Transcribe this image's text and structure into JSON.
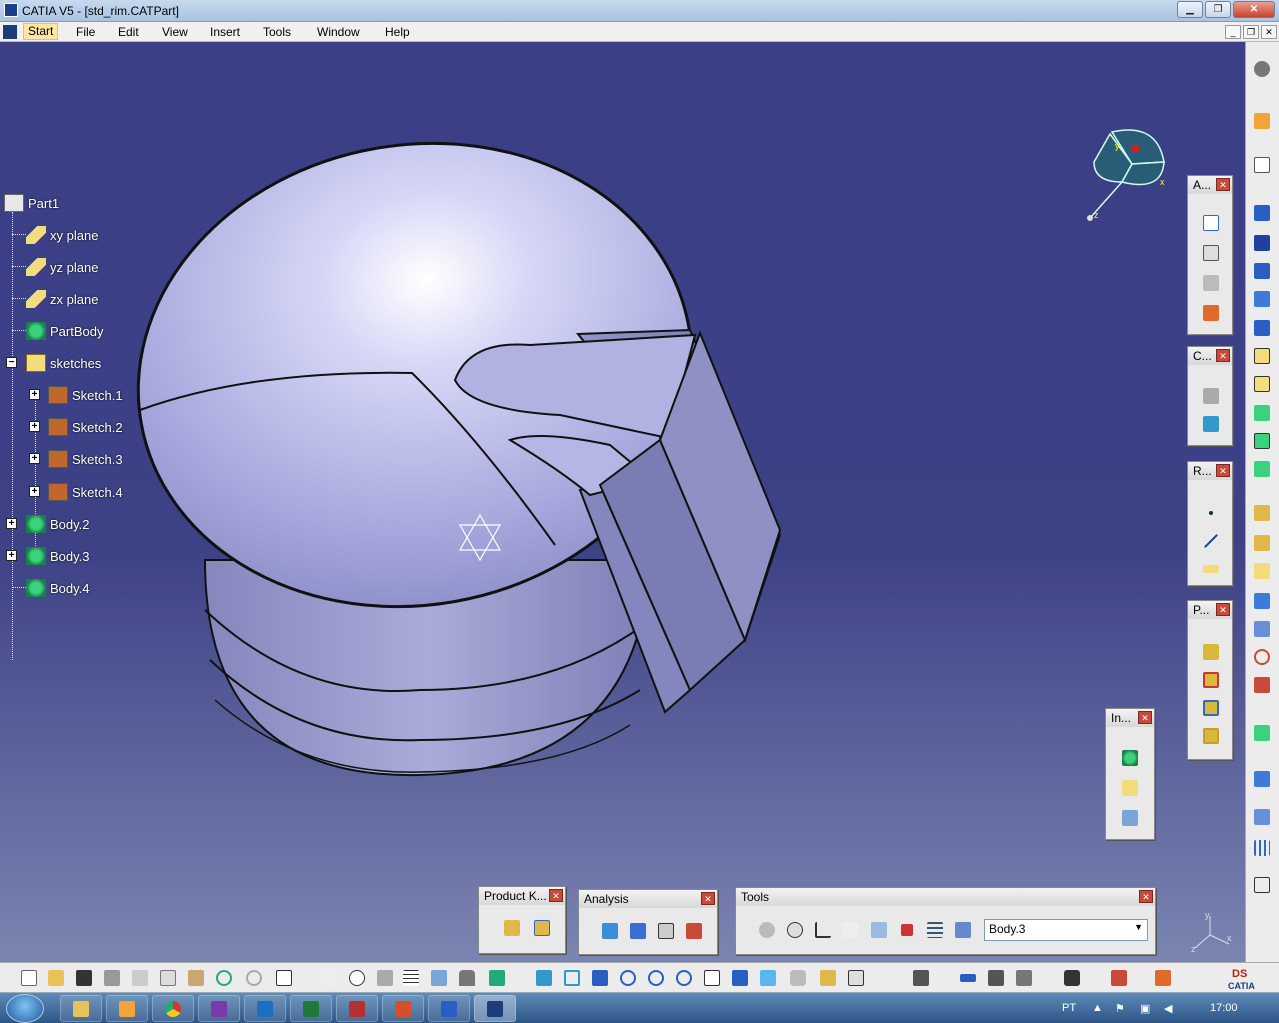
{
  "window": {
    "title": "CATIA V5 - [std_rim.CATPart]"
  },
  "menu": {
    "items": [
      "Start",
      "File",
      "Edit",
      "View",
      "Insert",
      "Tools",
      "Window",
      "Help"
    ]
  },
  "tree": {
    "root": "Part1",
    "nodes": [
      "xy plane",
      "yz plane",
      "zx plane",
      "PartBody",
      "sketches",
      "Sketch.1",
      "Sketch.2",
      "Sketch.3",
      "Sketch.4",
      "Body.2",
      "Body.3",
      "Body.4"
    ]
  },
  "compass": {
    "x_label": "x",
    "y_label": "y",
    "z_label": "z"
  },
  "toolbars": {
    "annotations": "A...",
    "constraints": "C...",
    "reference": "R...",
    "part": "P...",
    "insert": "In...",
    "product_knowledge": "Product K...",
    "analysis": "Analysis",
    "tools": "Tools",
    "tools_combo_value": "Body.3"
  },
  "axes_triad": {
    "y": "y",
    "x": "x",
    "z": "z"
  },
  "taskbar": {
    "lang": "PT",
    "clock": "17:00"
  },
  "colors": {
    "viewport_top": "#3a3f86",
    "viewport_bottom": "#7b85b1",
    "model_fill": "#b8b9e8",
    "accent": "#d11f1f"
  }
}
